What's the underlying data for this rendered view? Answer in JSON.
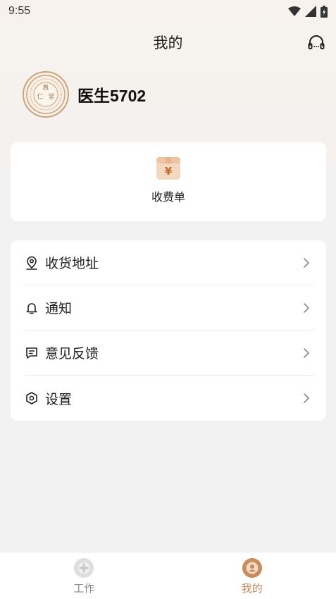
{
  "status_bar": {
    "time": "9:55"
  },
  "header": {
    "title": "我的"
  },
  "profile": {
    "name": "医生5702",
    "avatar_text": "胤仁堂"
  },
  "bill": {
    "label": "收费单",
    "icon_glyph": "¥"
  },
  "menu": [
    {
      "label": "收货地址",
      "icon": "location-pin-icon"
    },
    {
      "label": "通知",
      "icon": "bell-icon"
    },
    {
      "label": "意见反馈",
      "icon": "feedback-icon"
    },
    {
      "label": "设置",
      "icon": "settings-hexagon-icon"
    }
  ],
  "tabbar": {
    "tabs": [
      {
        "label": "工作",
        "active": false
      },
      {
        "label": "我的",
        "active": true
      }
    ]
  },
  "colors": {
    "accent": "#c08a5e",
    "inactive": "#8a8a8a"
  }
}
